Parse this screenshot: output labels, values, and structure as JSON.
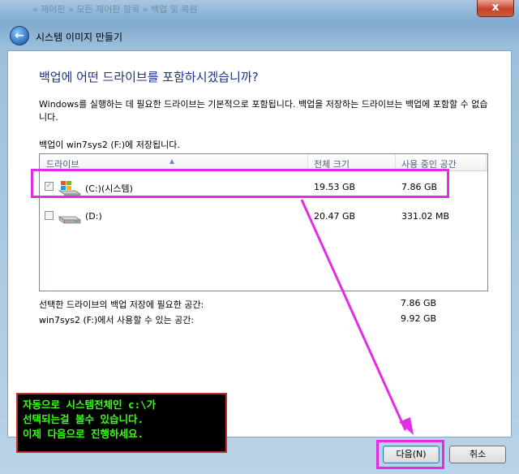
{
  "window": {
    "title_blurred": "« 제어판 » 모든 제어판 항목 » 백업 및 복원",
    "close_label": "x"
  },
  "nav": {
    "title": "시스템 이미지 만들기"
  },
  "heading": "백업에 어떤 드라이브를 포함하시겠습니까?",
  "description": "Windows를 실행하는 데 필요한 드라이브는 기본적으로 포함됩니다. 백업을 저장하는 드라이브는 백업에 포함할 수 없습니다.",
  "save_location": "백업이 win7sys2 (F:)에 저장됩니다.",
  "table": {
    "columns": [
      "드라이브",
      "전체 크기",
      "사용 중인 공간"
    ],
    "rows": [
      {
        "name": "(C:)(시스템)",
        "total": "19.53 GB",
        "used": "7.86 GB",
        "checked": true,
        "disabled": true
      },
      {
        "name": "(D:)",
        "total": "20.47 GB",
        "used": "331.02 MB",
        "checked": false,
        "disabled": false
      }
    ]
  },
  "summary": {
    "required_label": "선택한 드라이브의 백업 저장에 필요한 공간:",
    "required_value": "7.86 GB",
    "available_label": "win7sys2 (F:)에서 사용할 수 있는 공간:",
    "available_value": "9.92 GB"
  },
  "annotation": {
    "lines": [
      "자동으로 시스템전체인 c:\\가",
      "선택되는걸 볼수 있습니다.",
      "이제 다음으로 진행하세요."
    ],
    "color": "#39ff14",
    "highlight_color": "#e12de6"
  },
  "buttons": {
    "next": "다음(N)",
    "cancel": "취소"
  }
}
